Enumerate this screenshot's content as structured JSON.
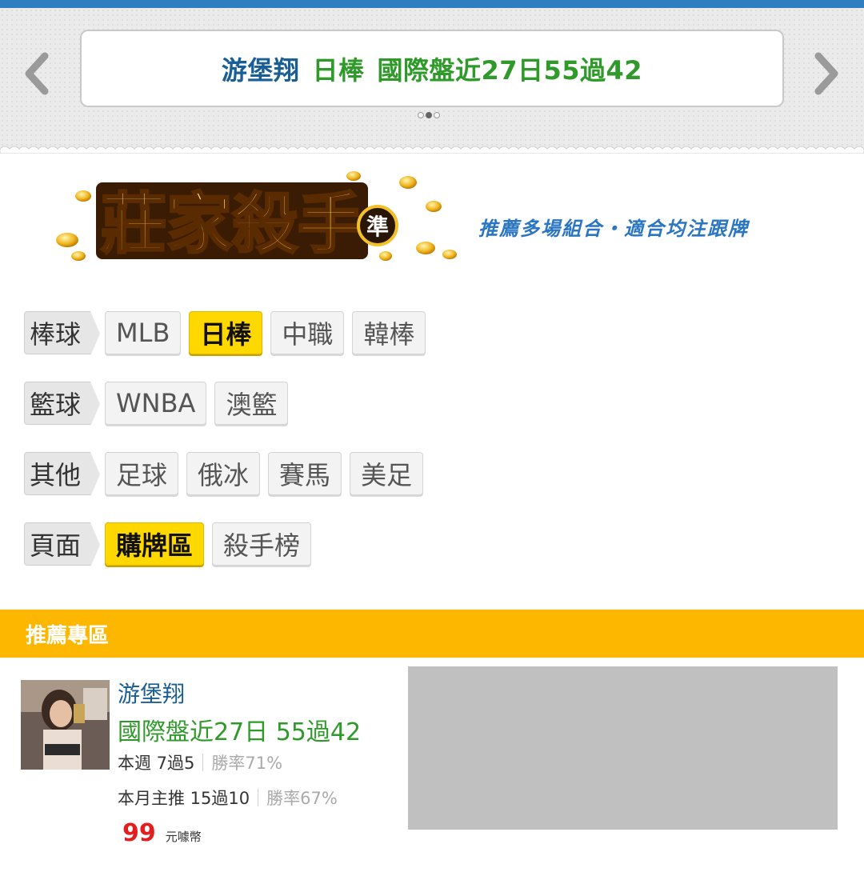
{
  "ticker": {
    "name": "游堡翔",
    "league": "日棒",
    "record": "國際盤近27日55過42",
    "dots_total": 3,
    "dots_active": 2
  },
  "header": {
    "logo_text": "莊家殺手",
    "logo_badge": "準",
    "slogan": "推薦多場組合・適合均注跟牌"
  },
  "filters": [
    {
      "label": "棒球",
      "chips": [
        {
          "text": "MLB",
          "active": false
        },
        {
          "text": "日棒",
          "active": true
        },
        {
          "text": "中職",
          "active": false
        },
        {
          "text": "韓棒",
          "active": false
        }
      ]
    },
    {
      "label": "籃球",
      "chips": [
        {
          "text": "WNBA",
          "active": false
        },
        {
          "text": "澳籃",
          "active": false
        }
      ]
    },
    {
      "label": "其他",
      "chips": [
        {
          "text": "足球",
          "active": false
        },
        {
          "text": "俄冰",
          "active": false
        },
        {
          "text": "賽馬",
          "active": false
        },
        {
          "text": "美足",
          "active": false
        }
      ]
    },
    {
      "label": "頁面",
      "chips": [
        {
          "text": "購牌區",
          "active": true
        },
        {
          "text": "殺手榜",
          "active": false
        }
      ]
    }
  ],
  "section": {
    "title": "推薦專區"
  },
  "card": {
    "name": "游堡翔",
    "record": "國際盤近27日 55過42",
    "week_label": "本週 7過5",
    "week_rate": "勝率71%",
    "month_label": "本月主推 15過10",
    "month_rate": "勝率67%",
    "price": "99",
    "unit": "元噱幣"
  },
  "colors": {
    "accent_yellow": "#ffd800",
    "section_bar": "#fdb700",
    "name_blue": "#1a5e96",
    "record_green": "#2f9a2a",
    "price_red": "#e21e1e"
  }
}
